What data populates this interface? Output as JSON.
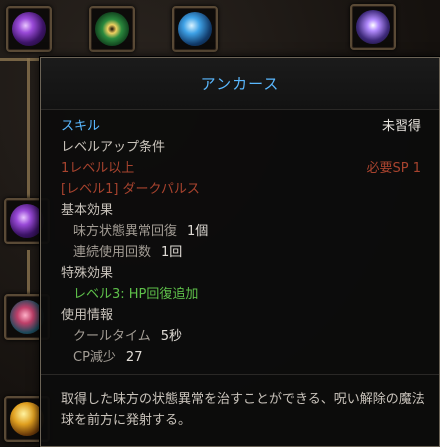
{
  "tooltip": {
    "title": "アンカース",
    "skill_label": "スキル",
    "skill_status": "未習得",
    "levelup_label": "レベルアップ条件",
    "req_level": "1レベル以上",
    "req_sp": "必要SP 1",
    "req_prereq": "[レベル1] ダークパルス",
    "basic_effect_label": "基本効果",
    "basic_effects": [
      {
        "name": "味方状態異常回復",
        "value": "1個"
      },
      {
        "name": "連続使用回数",
        "value": "1回"
      }
    ],
    "special_effect_label": "特殊効果",
    "special_effect": "レベル3: HP回復追加",
    "usage_label": "使用情報",
    "usage": [
      {
        "name": "クールタイム",
        "value": "5秒"
      },
      {
        "name": "CP減少",
        "value": "27"
      }
    ],
    "description": "取得した味方の状態異常を治すことができる、呪い解除の魔法球を前方に発射する。"
  },
  "colors": {
    "title_blue": "#5ab8ff",
    "requirement_red": "#a8432e",
    "special_green": "#5ec04a"
  },
  "skill_icons": [
    "purple-orb-icon",
    "green-rune-icon",
    "blue-orb-icon",
    "violet-orb-icon",
    "purple-orb-icon",
    "coral-plant-icon",
    "gold-orb-icon"
  ]
}
